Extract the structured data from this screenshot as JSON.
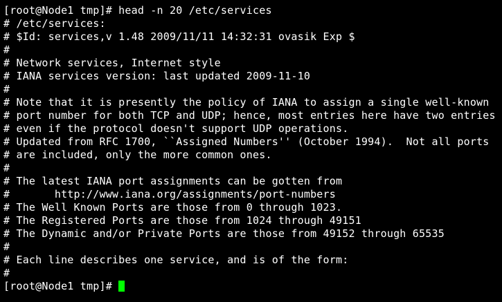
{
  "terminal": {
    "lines": [
      "[root@Node1 tmp]# head -n 20 /etc/services",
      "# /etc/services:",
      "# $Id: services,v 1.48 2009/11/11 14:32:31 ovasik Exp $",
      "#",
      "# Network services, Internet style",
      "# IANA services version: last updated 2009-11-10",
      "#",
      "# Note that it is presently the policy of IANA to assign a single well-known",
      "# port number for both TCP and UDP; hence, most entries here have two entries",
      "# even if the protocol doesn't support UDP operations.",
      "# Updated from RFC 1700, ``Assigned Numbers'' (October 1994).  Not all ports",
      "# are included, only the more common ones.",
      "#",
      "# The latest IANA port assignments can be gotten from",
      "#       http://www.iana.org/assignments/port-numbers",
      "# The Well Known Ports are those from 0 through 1023.",
      "# The Registered Ports are those from 1024 through 49151",
      "# The Dynamic and/or Private Ports are those from 49152 through 65535",
      "#",
      "# Each line describes one service, and is of the form:",
      "#"
    ],
    "prompt": "[root@Node1 tmp]# ",
    "colors": {
      "background": "#000000",
      "foreground": "#ffffff",
      "cursor": "#00ff00"
    }
  }
}
